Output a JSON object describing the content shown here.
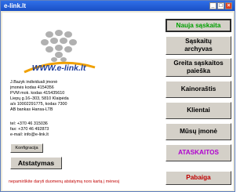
{
  "window": {
    "title": "e-link.lt"
  },
  "logo": {
    "text": "WWW.e-link.lt"
  },
  "company": {
    "lines": [
      "J.Bazyk individuali įmonė",
      "įmonės kodas 4154356",
      "PVM mok. kodas 415435610",
      "Liepų g.16–303, 5810 Klaipėda",
      "a/s 10002291775, kodas 7300",
      "AB bankas Hansa-LTB"
    ]
  },
  "contacts": {
    "lines": [
      "tel: +370 46 315036",
      "fax: +370 46 492873",
      "e-mail: info@e-link.lt"
    ]
  },
  "buttons": {
    "konfiguracija": "Konfigracija",
    "atstatymas": "Atstatymas"
  },
  "notice": "nepamirškite daryti duomenų atstatymą nors kartą į mėnesį",
  "menu": {
    "nauja": "Nauja sąskaita",
    "archyvas": "Sąskaitų\narchyvas",
    "paieska": "Greita sąskaitos\npaieška",
    "kainorastis": "Kainoraštis",
    "klientai": "Klientai",
    "imone": "Mūsų įmonė",
    "ataskaitos": "ATASKAITOS",
    "pabaiga": "Pabaiga"
  },
  "colors": {
    "nauja_text": "#00a000",
    "ataskaitos_text": "#b000d0",
    "pabaiga_text": "#c00000",
    "notice_text": "#c00000",
    "logo_blue": "#1e3d9a"
  }
}
